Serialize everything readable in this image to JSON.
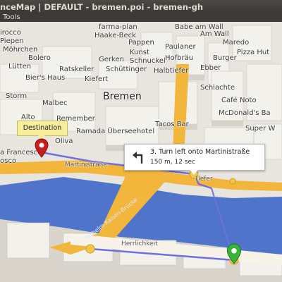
{
  "window": {
    "title": "nceMap | DEFAULT - bremen.poi - bremen-gh"
  },
  "menu": {
    "tools_label": "Tools"
  },
  "map": {
    "city_label": "Bremen",
    "place_labels": {
      "farma_plan": "farma-plan",
      "babe_am_wall": "Babe am Wall",
      "scirocco": "irocco",
      "haake_beck": "Haake-Beck",
      "piepen": "Piepen",
      "am_wall": "Am Wall",
      "moehrchen": "Möhrchen",
      "pappen": "Pappen",
      "paulaner": "Paulaner",
      "bolero": "Bolero",
      "kunst": "Kunst",
      "luetten": "Lütten",
      "gerken": "Gerken",
      "schnuckel": "Schnuckel",
      "hofbraeu": "Hofbräu",
      "ratskeller": "Ratskeller",
      "schuettinger": "Schüttinger",
      "biers_haus": "Bier's Haus",
      "halbtiefer": "Halbtiefer",
      "burger": "Burger",
      "pizza_hut": "Pizza Hut",
      "maredo": "Maredo",
      "ebber": "Ebber",
      "schlachte": "Schlachte",
      "kiefert": "Kiefert",
      "cafe_noto": "Café Noto",
      "storm": "Storm",
      "malbec": "Malbec",
      "remember": "Remember",
      "mcdonalds": "McDonald's Ba",
      "alto": "Alto",
      "ramada": "Ramada Überseehotel",
      "tacos_bar": "Tacos Bar",
      "super_w": "Super W",
      "oliva": "Oliva",
      "francesco": "a Francesco",
      "osco": "osco",
      "martinistrasse_left": "Martinistraße",
      "tiefer": "Tiefer",
      "herrlichkeit": "Herrlichkeit",
      "wilhelm_kaisen": "Wilhelm-Kaisen-Brücke"
    },
    "destination_tooltip": "Destination",
    "route_instruction": {
      "text": "3. Turn left onto Martinistraße",
      "detail": "150 m, 12 sec"
    },
    "icons": {
      "destination_pin": "red-map-pin",
      "start_pin": "green-map-pin",
      "turn_arrow": "turn-left-arrow"
    },
    "colors": {
      "route_line": "#6f6fe0",
      "road_major": "#f2b63c",
      "river": "#4f74c9",
      "destination_pin": "#c81d1d",
      "start_pin": "#39b43a",
      "tooltip_bg": "#f7ef9e"
    }
  }
}
